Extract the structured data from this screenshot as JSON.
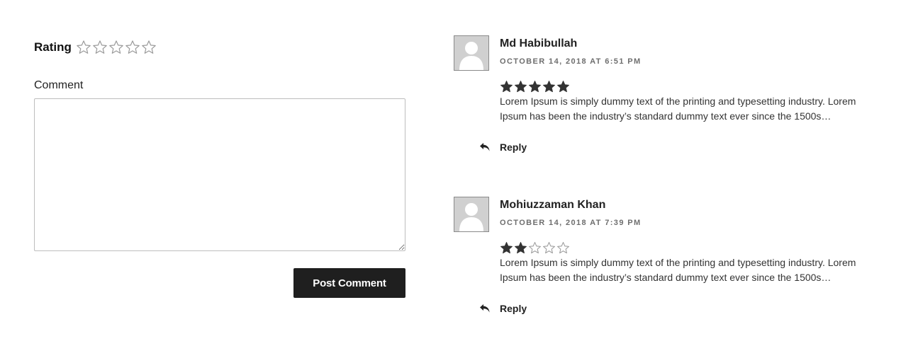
{
  "form": {
    "rating_label": "Rating",
    "rating_value": 0,
    "rating_max": 5,
    "comment_label": "Comment",
    "comment_value": "",
    "submit_label": "Post Comment"
  },
  "comments": [
    {
      "author": "Md Habibullah",
      "date": "OCTOBER 14, 2018 AT 6:51 PM",
      "rating": 5,
      "text": "Lorem Ipsum is simply dummy text of the printing and typesetting industry. Lorem Ipsum has been the industry’s standard dummy text ever since the 1500s…",
      "reply_label": "Reply"
    },
    {
      "author": "Mohiuzzaman Khan",
      "date": "OCTOBER 14, 2018 AT 7:39 PM",
      "rating": 2,
      "text": "Lorem Ipsum is simply dummy text of the printing and typesetting industry. Lorem Ipsum has been the industry’s standard dummy text ever since the 1500s…",
      "reply_label": "Reply"
    }
  ],
  "icons": {
    "empty_star": "star-outline-icon",
    "filled_star": "star-filled-icon",
    "avatar": "default-avatar-icon",
    "reply": "reply-arrow-icon"
  },
  "colors": {
    "star_filled": "#333333",
    "star_outline": "#9a9a9a",
    "button_bg": "#1f1f1f",
    "button_text": "#ffffff",
    "date_text": "#6e6e6e"
  }
}
